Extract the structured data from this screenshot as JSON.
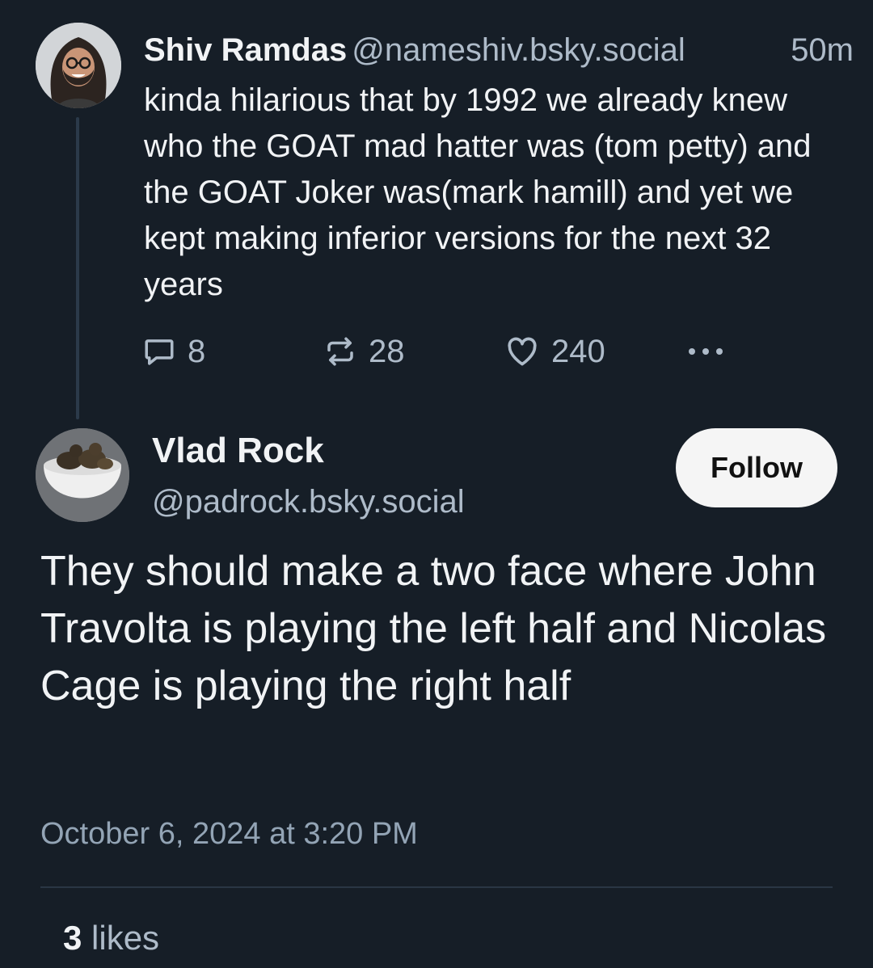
{
  "parent_post": {
    "author_name": "Shiv Ramdas",
    "author_handle": "@nameshiv.bsky.social",
    "timestamp": "50m",
    "text": "kinda hilarious that by 1992 we already knew who the GOAT mad hatter was (tom petty) and the GOAT Joker was(mark hamill) and yet we kept making inferior versions for the next 32 years",
    "reply_count": "8",
    "repost_count": "28",
    "like_count": "240"
  },
  "reply_post": {
    "author_name": "Vlad Rock",
    "author_handle": "@padrock.bsky.social",
    "follow_label": "Follow",
    "text": "They should make a two face where John Travolta is playing the left half and Nicolas Cage is playing the right half",
    "date": "October 6, 2024 at 3:20 PM",
    "likes_count": "3",
    "likes_label": "likes"
  },
  "colors": {
    "background": "#161e27",
    "primary_text": "#f1f3f5",
    "secondary_text": "#aebbc9",
    "thread_line": "#2b3a4a",
    "follow_button_bg": "#f5f5f5"
  },
  "icons": {
    "reply": "speech-bubble-icon",
    "repost": "repost-arrows-icon",
    "like": "heart-icon",
    "more": "ellipsis-icon"
  }
}
